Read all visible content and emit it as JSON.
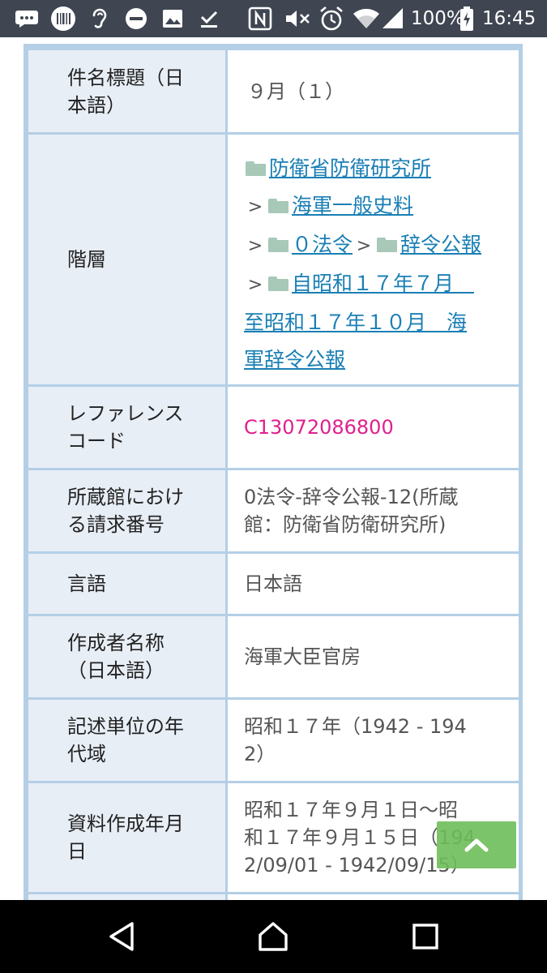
{
  "status_bar": {
    "battery": "100%",
    "time": "16:45",
    "icons": [
      "chat-bubble-icon",
      "barcode-icon",
      "hearing-icon",
      "do-not-disturb-icon",
      "image-icon",
      "download-done-icon",
      "nfc-icon",
      "mute-icon",
      "alarm-icon",
      "wifi-icon",
      "signal-icon",
      "battery-charging-icon"
    ]
  },
  "table": {
    "title_row": {
      "label": "件名標題（日\n本語）",
      "value": "９月（１）"
    },
    "hierarchy_row": {
      "label": "階層",
      "links": [
        "防衛省防衛研究所",
        "海軍一般史料",
        "０法令",
        "辞令公報",
        "自昭和１７年７月　",
        "至昭和１７年１０月　海",
        "軍辞令公報"
      ]
    },
    "reference_row": {
      "label": "レファレンス\nコード",
      "value": "C13072086800"
    },
    "call_number_row": {
      "label": "所蔵館におけ\nる請求番号",
      "value": "0法令-辞令公報-12(所蔵\n館：防衛省防衛研究所)"
    },
    "language_row": {
      "label": "言語",
      "value": "日本語"
    },
    "creator_row": {
      "label": "作成者名称\n（日本語）",
      "value": "海軍大臣官房"
    },
    "era_row": {
      "label": "記述単位の年\n代域",
      "value": "昭和１７年（1942 - 194\n2）"
    },
    "date_row": {
      "label": "資料作成年月\n日",
      "value": "昭和１７年９月１日～昭\n和１７年９月１５日（194\n2/09/01 - 1942/09/15）"
    }
  },
  "scroll_top_button": {
    "icon": "chevron-up-icon"
  },
  "nav_bar": {
    "icons": [
      "back-icon",
      "home-icon",
      "recents-icon"
    ]
  },
  "colors": {
    "link": "#1a7fb5",
    "reference_code": "#e0208c",
    "header_cell": "#e8eef6",
    "table_border": "#b4cfe6",
    "status_bar": "#3f4652"
  }
}
